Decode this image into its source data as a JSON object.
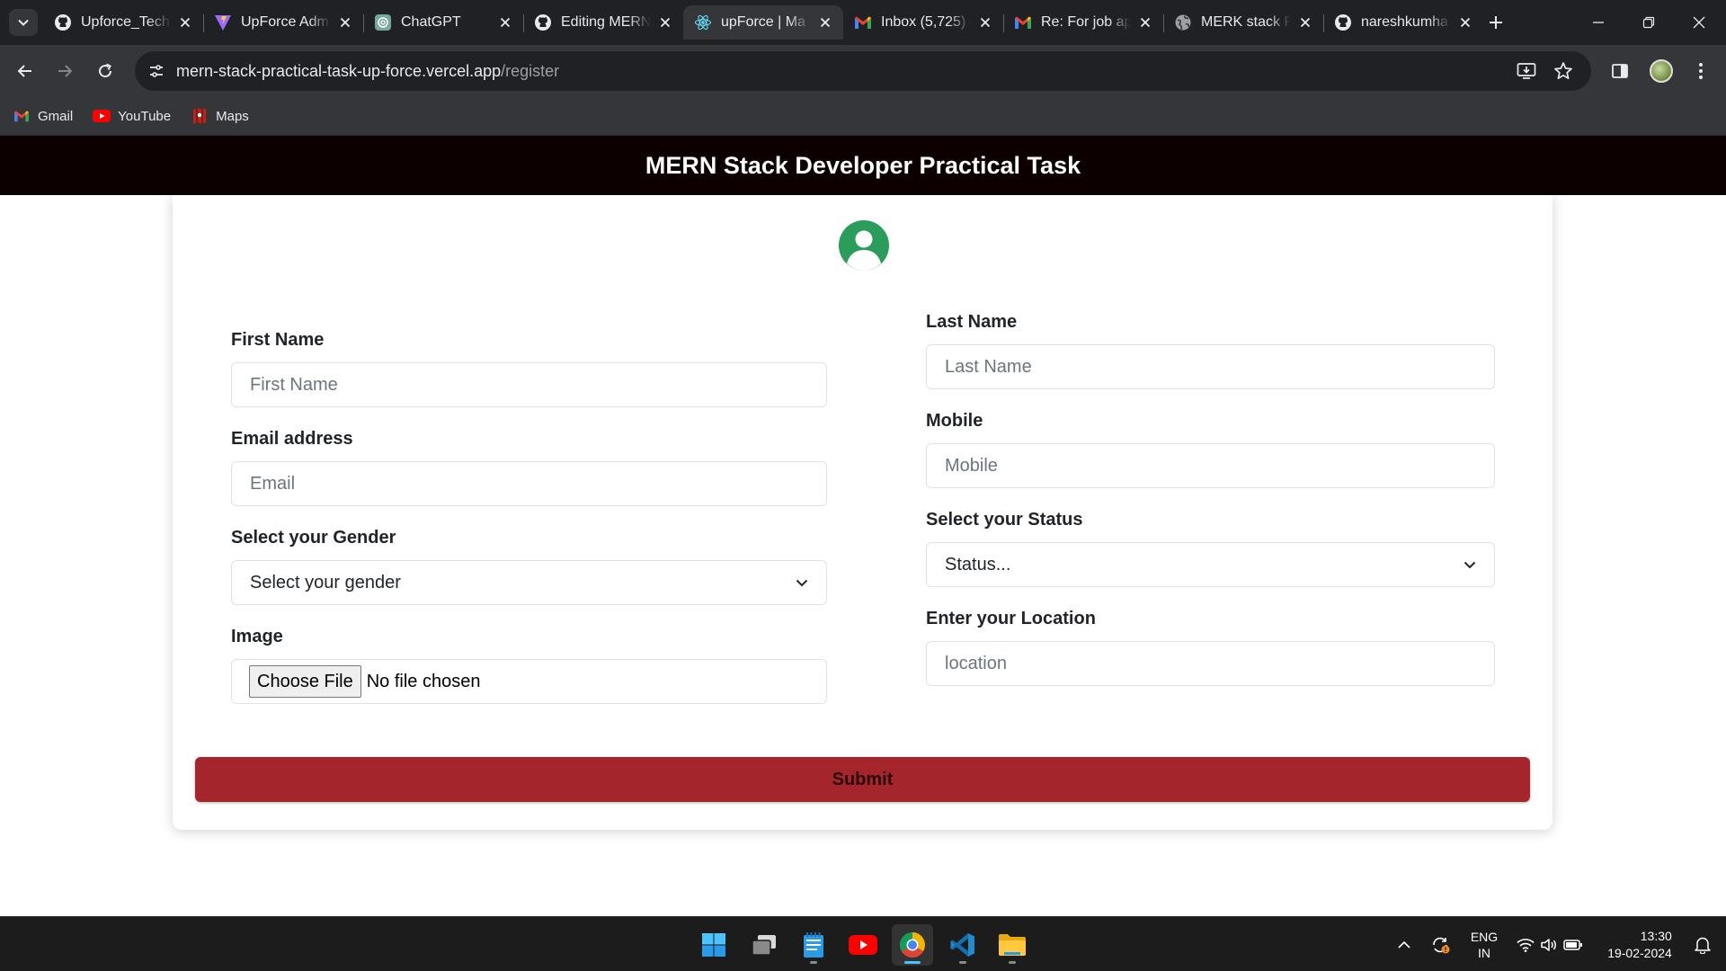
{
  "browser": {
    "tabs": [
      {
        "title": "Upforce_Tech",
        "icon": "github-icon",
        "active": false
      },
      {
        "title": "UpForce Adm",
        "icon": "vite-icon",
        "active": false
      },
      {
        "title": "ChatGPT",
        "icon": "chatgpt-icon",
        "active": false
      },
      {
        "title": "Editing MERN",
        "icon": "github-icon",
        "active": false
      },
      {
        "title": "upForce | Ma",
        "icon": "react-icon",
        "active": true
      },
      {
        "title": "Inbox (5,725)",
        "icon": "gmail-icon",
        "active": false
      },
      {
        "title": "Re: For job ap",
        "icon": "gmail-icon",
        "active": false
      },
      {
        "title": "MERK stack P",
        "icon": "globe-icon",
        "active": false
      },
      {
        "title": "nareshkumha",
        "icon": "github-icon",
        "active": false
      }
    ],
    "url_host": "mern-stack-practical-task-up-force.vercel.app",
    "url_path": "/register",
    "bookmarks": [
      {
        "label": "Gmail",
        "icon": "gmail-icon"
      },
      {
        "label": "YouTube",
        "icon": "youtube-icon"
      },
      {
        "label": "Maps",
        "icon": "maps-icon"
      }
    ]
  },
  "app": {
    "title": "MERN Stack Developer Practical Task"
  },
  "form": {
    "first_name": {
      "label": "First Name",
      "placeholder": "First Name"
    },
    "last_name": {
      "label": "Last Name",
      "placeholder": "Last Name"
    },
    "email": {
      "label": "Email address",
      "placeholder": "Email"
    },
    "mobile": {
      "label": "Mobile",
      "placeholder": "Mobile"
    },
    "gender": {
      "label": "Select your Gender",
      "selected": "Select your gender"
    },
    "status": {
      "label": "Select your Status",
      "selected": "Status..."
    },
    "image": {
      "label": "Image",
      "button": "Choose File",
      "file_text": "No file chosen"
    },
    "location": {
      "label": "Enter your Location",
      "placeholder": "location"
    },
    "submit_label": "Submit"
  },
  "taskbar": {
    "apps": [
      "windows-start-icon",
      "task-view-icon",
      "notepad-icon",
      "youtube-app-icon",
      "chrome-icon",
      "vscode-icon",
      "file-explorer-icon"
    ],
    "language_top": "ENG",
    "language_bottom": "IN",
    "time": "13:30",
    "date": "19-02-2024"
  },
  "colors": {
    "header_bg": "#0d0000",
    "submit_bg": "#a4262c",
    "avatar": "#2a9d5c",
    "chrome_dark": "#202124",
    "chrome_mid": "#35363a"
  }
}
